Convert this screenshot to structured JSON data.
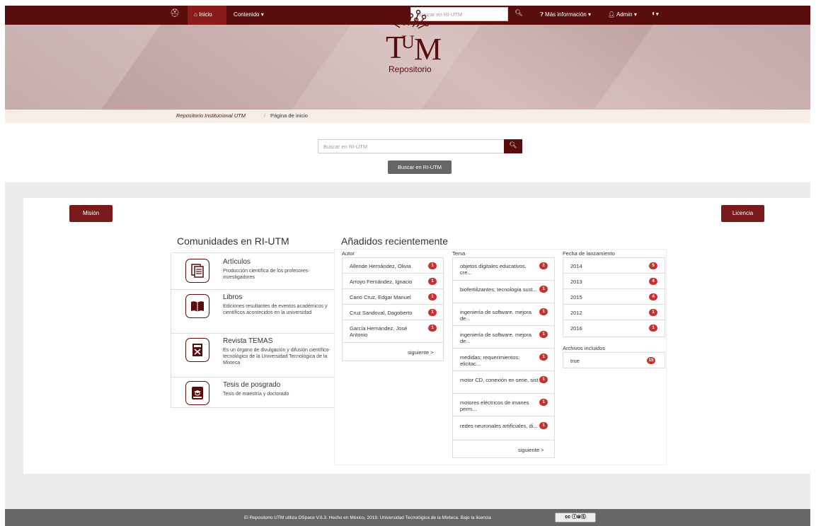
{
  "topbar": {
    "home_label": "Inicio",
    "contenido_label": "Contenido",
    "search_placeholder": "Buscar en RI-UTM",
    "more_info_label": "Más información",
    "admin_label": "Admin",
    "lang_icon": "globe-icon"
  },
  "banner": {
    "logo_text": "Repositorio",
    "logo_letters": "TUM"
  },
  "breadcrumb": {
    "home": "Repositorio Institucional UTM",
    "separator": "/",
    "current": "Página de inicio"
  },
  "search": {
    "placeholder": "Buscar en RI-UTM",
    "submit_label": "Buscar en RI-UTM"
  },
  "buttons": {
    "mision": "Misión",
    "licencia": "Licencia"
  },
  "communities": {
    "title": "Comunidades en RI-UTM",
    "items": [
      {
        "name": "Artículos",
        "desc": "Producción científica de los profesores-investigadores",
        "icon": "document-stack-icon"
      },
      {
        "name": "Libros",
        "desc": "Ediciones resultantes de eventos académicos y científicos acontecidos en la universidad",
        "icon": "open-book-icon"
      },
      {
        "name": "Revista TEMAS",
        "desc": "Es un órgano de divulgación y difusión científico-tecnológico de la Universidad Tecnológica de la Mixteca",
        "icon": "magazine-icon"
      },
      {
        "name": "Tesis de posgrado",
        "desc": "Tesis de maestría y doctorado",
        "icon": "graduation-book-icon"
      }
    ]
  },
  "recent": {
    "title": "Añadidos recientemente",
    "autor": {
      "label": "Autor",
      "items": [
        {
          "text": "Allende Hernández, Olivia",
          "count": "1"
        },
        {
          "text": "Arroyo Fernández, Ignacio",
          "count": "1"
        },
        {
          "text": "Cano Cruz, Edgar Manuel",
          "count": "1"
        },
        {
          "text": "Cruz Sandoval, Dagoberto",
          "count": "1"
        },
        {
          "text": "García Hernández, José Antonio",
          "count": "1"
        }
      ],
      "next": "siguiente >"
    },
    "tema": {
      "label": "Tema",
      "items": [
        {
          "text": "objetos digitales educativos, cre...",
          "count": "2"
        },
        {
          "text": "biofertilizantes; tecnología sust...",
          "count": "1"
        },
        {
          "text": "ingeniería de software, mejora de...",
          "count": "1"
        },
        {
          "text": "ingeniería de software, mejora de...",
          "count": "1"
        },
        {
          "text": "medidas; requerimientos; elicitac...",
          "count": "1"
        },
        {
          "text": "motor CD, conexión en serie, sist...",
          "count": "1"
        },
        {
          "text": "motores eléctricos de imanes perm...",
          "count": "1"
        },
        {
          "text": "redes neuronales artificiales, di...",
          "count": "1"
        }
      ],
      "next": "siguiente >"
    },
    "fecha": {
      "label": "Fecha de lanzamiento",
      "items": [
        {
          "text": "2014",
          "count": "5"
        },
        {
          "text": "2013",
          "count": "4"
        },
        {
          "text": "2015",
          "count": "4"
        },
        {
          "text": "2012",
          "count": "1"
        },
        {
          "text": "2016",
          "count": "1"
        }
      ]
    },
    "archivos": {
      "label": "Archivos incluidos",
      "items": [
        {
          "text": "true",
          "count": "15"
        }
      ]
    }
  },
  "footer": {
    "text": "El Repositorio UTM utiliza DSpace V.6.3. Hecho en México, 2019. Universidad Tecnológica de la Mixteca. Bajo la licencia",
    "cc_badge": "cc ⓘ⊜Ⓢ"
  },
  "colors": {
    "brand": "#5a0d0d",
    "accent": "#7a1a1a",
    "badge": "#c9302c"
  }
}
